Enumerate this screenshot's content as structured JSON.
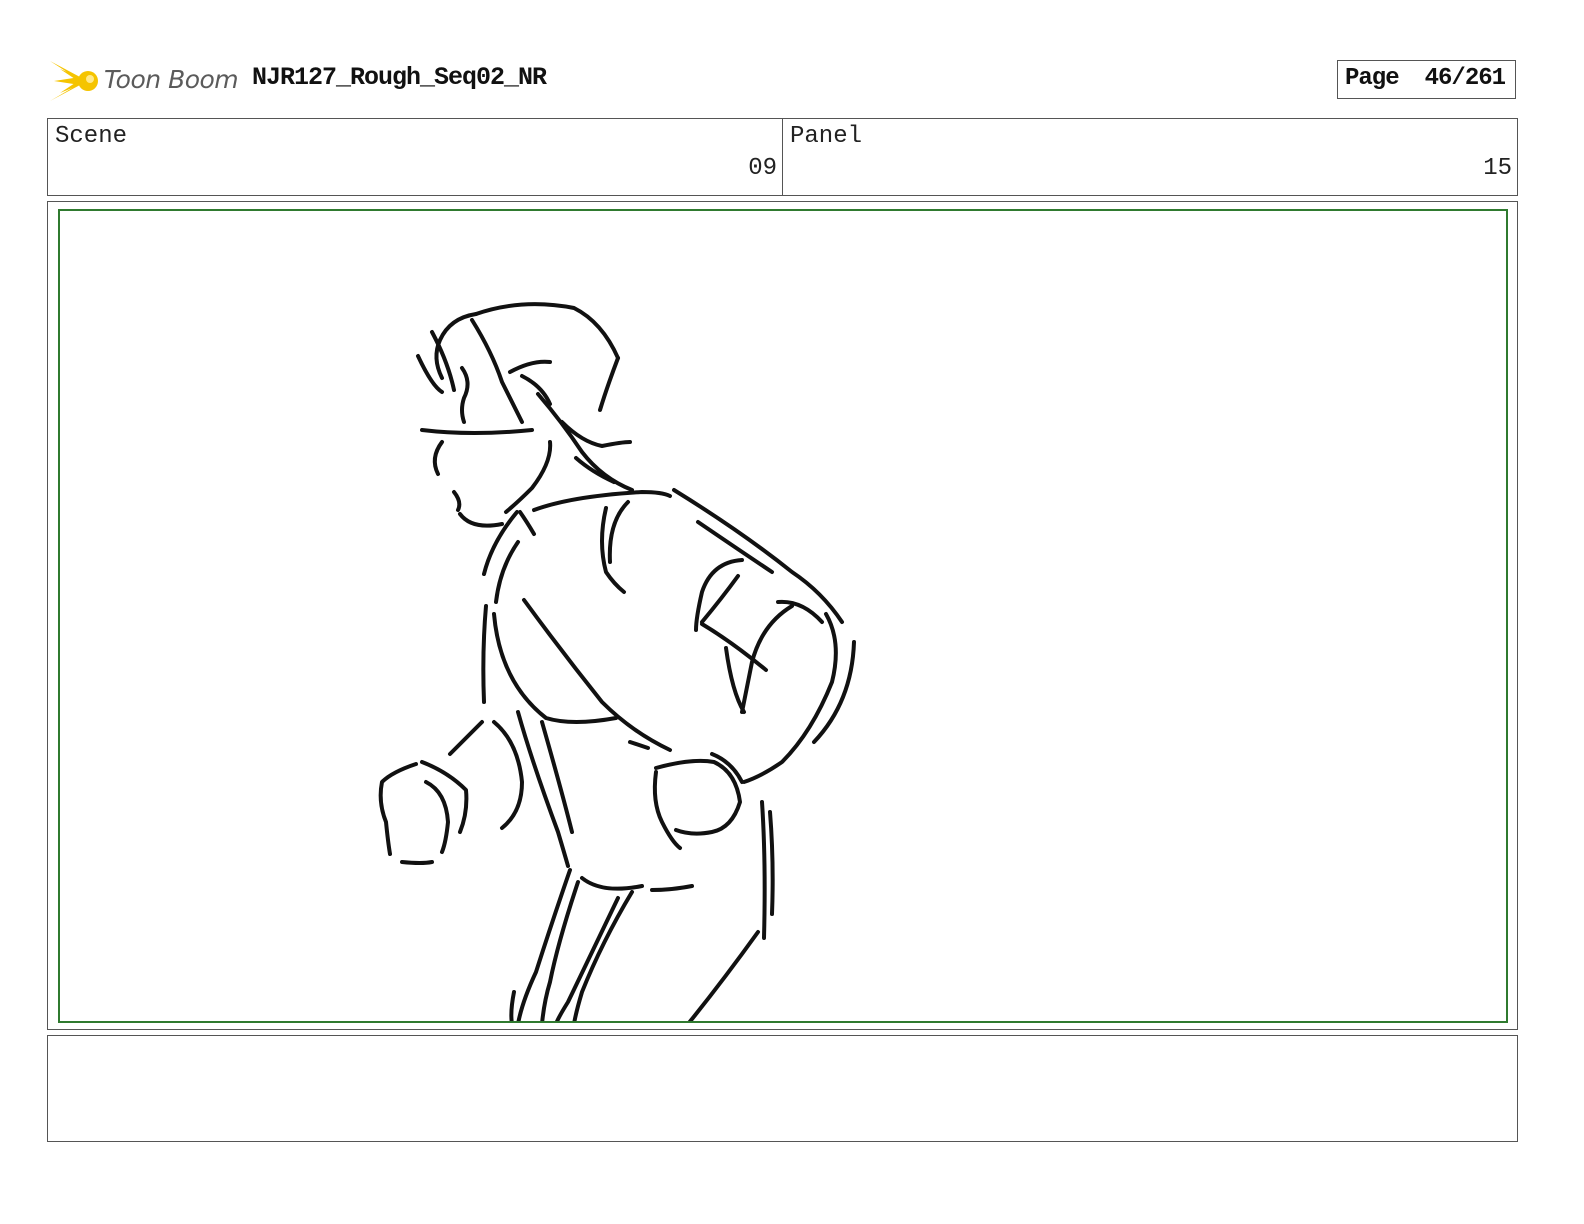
{
  "header": {
    "logo_text": "Toon Boom",
    "document_title": "NJR127_Rough_Seq02_NR",
    "page_label": "Page",
    "page_number": "46/261"
  },
  "info": {
    "scene_label": "Scene",
    "scene_value": "09",
    "panel_label": "Panel",
    "panel_value": "15"
  },
  "notes": {
    "text": ""
  },
  "colors": {
    "safe_frame": "#2f7a2f",
    "logo_star": "#f5c400",
    "logo_text": "#5b5b5b"
  }
}
